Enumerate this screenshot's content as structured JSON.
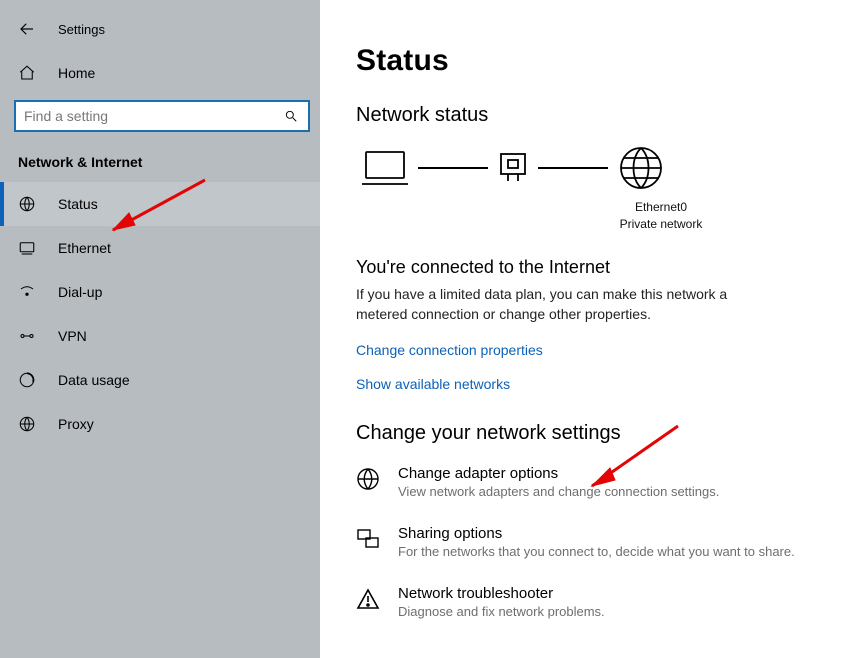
{
  "header": {
    "settings_label": "Settings"
  },
  "home": {
    "label": "Home"
  },
  "search": {
    "placeholder": "Find a setting"
  },
  "category": "Network & Internet",
  "sidebar": {
    "items": [
      {
        "label": "Status"
      },
      {
        "label": "Ethernet"
      },
      {
        "label": "Dial-up"
      },
      {
        "label": "VPN"
      },
      {
        "label": "Data usage"
      },
      {
        "label": "Proxy"
      }
    ]
  },
  "main": {
    "title": "Status",
    "network_status_heading": "Network status",
    "diagram": {
      "interface_name": "Ethernet0",
      "network_type": "Private network"
    },
    "connected_heading": "You're connected to the Internet",
    "connected_desc": "If you have a limited data plan, you can make this network a metered connection or change other properties.",
    "change_props_link": "Change connection properties",
    "show_networks_link": "Show available networks",
    "change_settings_heading": "Change your network settings",
    "options": [
      {
        "title": "Change adapter options",
        "subtitle": "View network adapters and change connection settings."
      },
      {
        "title": "Sharing options",
        "subtitle": "For the networks that you connect to, decide what you want to share."
      },
      {
        "title": "Network troubleshooter",
        "subtitle": "Diagnose and fix network problems."
      }
    ]
  }
}
